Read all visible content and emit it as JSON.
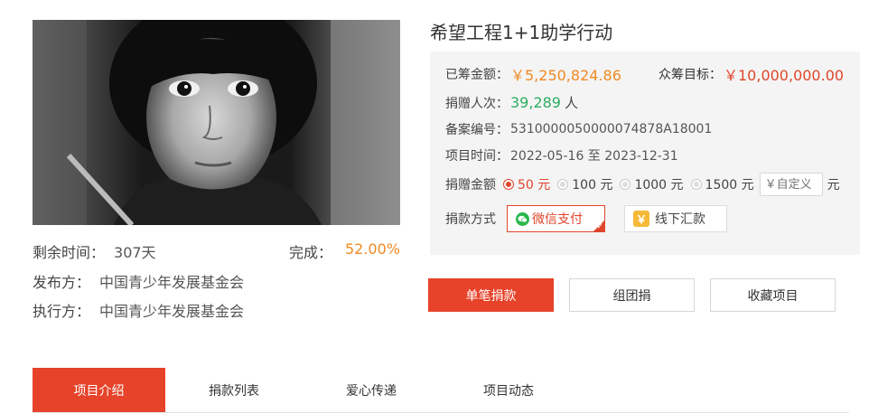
{
  "project": {
    "title": "希望工程1+1助学行动"
  },
  "stats": {
    "remaining_label": "剩余时间：",
    "remaining_value": "307天",
    "done_label": "完成：",
    "done_value": "52.00%"
  },
  "publisher": {
    "label": "发布方：",
    "value": "中国青少年发展基金会"
  },
  "executor": {
    "label": "执行方：",
    "value": "中国青少年发展基金会"
  },
  "info": {
    "raised_label": "已筹金额：",
    "raised_value": "￥5,250,824.86",
    "goal_label": "众筹目标：",
    "goal_value": "￥10,000,000.00",
    "donors_label": "捐赠人次：",
    "donors_value": "39,289",
    "donors_unit": "人",
    "record_label": "备案编号：",
    "record_value": "5310000050000074878A18001",
    "period_label": "项目时间：",
    "period_value": "2022-05-16 至 2023-12-31"
  },
  "amount": {
    "label": "捐赠金额",
    "options": [
      {
        "label": "50 元",
        "selected": true
      },
      {
        "label": "100 元",
        "selected": false
      },
      {
        "label": "1000 元",
        "selected": false
      },
      {
        "label": "1500 元",
        "selected": false
      }
    ],
    "custom_placeholder": "￥自定义",
    "custom_unit": "元"
  },
  "payment": {
    "label": "捐款方式",
    "wechat_label": "微信支付",
    "offline_label": "线下汇款",
    "offline_icon": "￥"
  },
  "actions": {
    "donate": "单笔捐款",
    "group": "组团捐",
    "favorite": "收藏项目"
  },
  "tabs": [
    {
      "label": "项目介绍",
      "active": true
    },
    {
      "label": "捐款列表",
      "active": false
    },
    {
      "label": "爱心传递",
      "active": false
    },
    {
      "label": "项目动态",
      "active": false
    }
  ],
  "colors": {
    "accent_red": "#e6432a",
    "orange": "#f08a24",
    "green": "#2dad5f"
  }
}
